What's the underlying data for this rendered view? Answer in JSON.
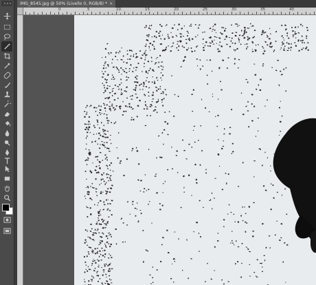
{
  "document": {
    "tab_title": "IMG_8545.jpg @ 50% (Livello 0, RGB/8) *",
    "close_glyph": "×"
  },
  "ruler": {
    "top_labels": [
      "0",
      "5",
      "10",
      "15",
      "20",
      "25",
      "30",
      "35",
      "40"
    ]
  },
  "tools": [
    {
      "name": "move-tool-icon",
      "active": false
    },
    {
      "name": "marquee-tool-icon",
      "active": false
    },
    {
      "name": "lasso-tool-icon",
      "active": false
    },
    {
      "name": "magic-wand-tool-icon",
      "active": true
    },
    {
      "name": "crop-tool-icon",
      "active": false
    },
    {
      "name": "eyedropper-tool-icon",
      "active": false
    },
    {
      "name": "healing-brush-tool-icon",
      "active": false
    },
    {
      "name": "brush-tool-icon",
      "active": false
    },
    {
      "name": "clone-stamp-tool-icon",
      "active": false
    },
    {
      "name": "history-brush-tool-icon",
      "active": false
    },
    {
      "name": "eraser-tool-icon",
      "active": false
    },
    {
      "name": "paint-bucket-tool-icon",
      "active": false
    },
    {
      "name": "blur-tool-icon",
      "active": false
    },
    {
      "name": "dodge-tool-icon",
      "active": false
    },
    {
      "name": "pen-tool-icon",
      "active": false
    },
    {
      "name": "type-tool-icon",
      "active": false
    },
    {
      "name": "path-selection-tool-icon",
      "active": false
    },
    {
      "name": "rectangle-tool-icon",
      "active": false
    },
    {
      "name": "hand-tool-icon",
      "active": false
    },
    {
      "name": "zoom-tool-icon",
      "active": false
    }
  ],
  "colors": {
    "foreground": "#000000",
    "background": "#ffffff",
    "canvas": "#e8ecef"
  }
}
